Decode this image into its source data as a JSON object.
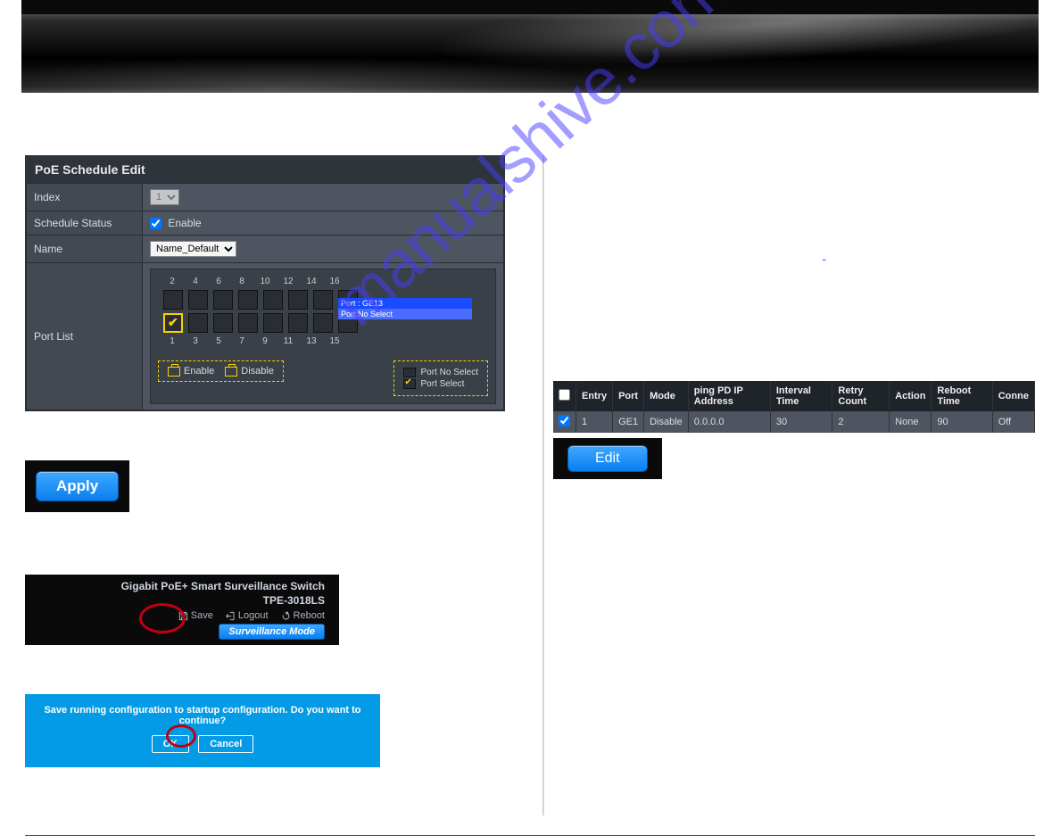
{
  "panel": {
    "title": "PoE Schedule Edit",
    "rows": {
      "index_label": "Index",
      "index_value": "1",
      "status_label": "Schedule Status",
      "enable_label": "Enable",
      "name_label": "Name",
      "name_value": "Name_Default",
      "portlist_label": "Port List"
    },
    "ports_top": [
      "2",
      "4",
      "6",
      "8",
      "10",
      "12",
      "14",
      "16"
    ],
    "ports_bottom": [
      "1",
      "3",
      "5",
      "7",
      "9",
      "11",
      "13",
      "15"
    ],
    "tooltip": {
      "line1": "Port : GE13",
      "line2": "Port No Select"
    },
    "enable_btn": "Enable",
    "disable_btn": "Disable",
    "legend_noselect": "Port No Select",
    "legend_select": "Port Select"
  },
  "apply_btn": "Apply",
  "save_shot": {
    "line1": "Gigabit PoE+ Smart Surveillance Switch",
    "line2": "TPE-3018LS",
    "save": "Save",
    "logout": "Logout",
    "reboot": "Reboot",
    "surv": "Surveillance Mode"
  },
  "confirm": {
    "msg": "Save running configuration to startup configuration. Do you want to continue?",
    "ok": "OK",
    "cancel": "Cancel"
  },
  "pd_alive": {
    "headers": [
      "",
      "Entry",
      "Port",
      "Mode",
      "ping PD IP Address",
      "Interval Time",
      "Retry Count",
      "Action",
      "Reboot Time",
      "Conne"
    ],
    "row": [
      "",
      "1",
      "GE1",
      "Disable",
      "0.0.0.0",
      "30",
      "2",
      "None",
      "90",
      "Off"
    ]
  },
  "edit_btn": "Edit"
}
